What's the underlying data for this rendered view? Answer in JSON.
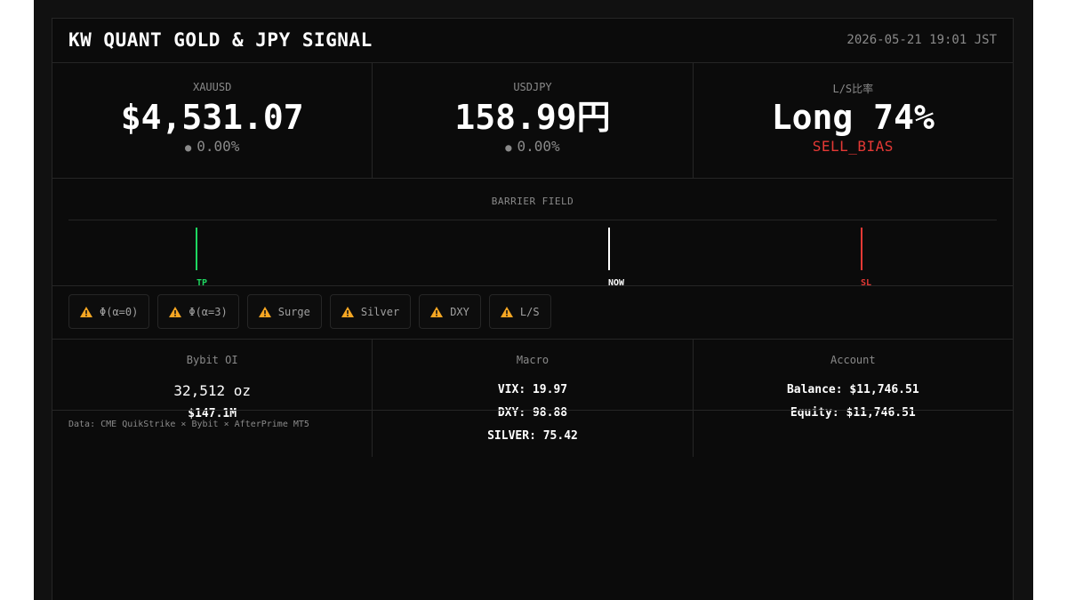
{
  "header": {
    "title": "KW QUANT GOLD & JPY SIGNAL",
    "timestamp": "2026-05-21 19:01 JST"
  },
  "metrics": [
    {
      "label": "XAUUSD",
      "value": "$4,531.07",
      "change": "0.00%"
    },
    {
      "label": "USDJPY",
      "value": "158.99円",
      "change": "0.00%"
    },
    {
      "label": "L/S比率",
      "value": "Long 74%",
      "bias": "SELL_BIAS"
    }
  ],
  "barrier": {
    "label": "BARRIER FIELD",
    "markers": [
      {
        "label": "TP",
        "color": "#1ed760"
      },
      {
        "label": "NOW",
        "color": "#ffffff"
      },
      {
        "label": "SL",
        "color": "#e53935"
      }
    ]
  },
  "warnings": [
    {
      "icon": "warning-icon",
      "label": "Φ(α=0)"
    },
    {
      "icon": "warning-icon",
      "label": "Φ(α=3)"
    },
    {
      "icon": "warning-icon",
      "label": "Surge"
    },
    {
      "icon": "warning-icon",
      "label": "Silver"
    },
    {
      "icon": "warning-icon",
      "label": "DXY"
    },
    {
      "icon": "warning-icon",
      "label": "L/S"
    }
  ],
  "bybit": {
    "label": "Bybit OI",
    "oz": "32,512 oz",
    "usd": "$147.1M"
  },
  "macro": {
    "label": "Macro",
    "lines": [
      "VIX: 19.97",
      "DXY: 98.88",
      "SILVER: 75.42"
    ]
  },
  "account": {
    "label": "Account",
    "lines": [
      "Balance: $11,746.51",
      "Equity: $11,746.51"
    ]
  },
  "source": "Data: CME QuikStrike × Bybit × AfterPrime MT5",
  "colors": {
    "accent_green": "#1ed760",
    "accent_red": "#e53935",
    "warning": "#f5a623"
  }
}
